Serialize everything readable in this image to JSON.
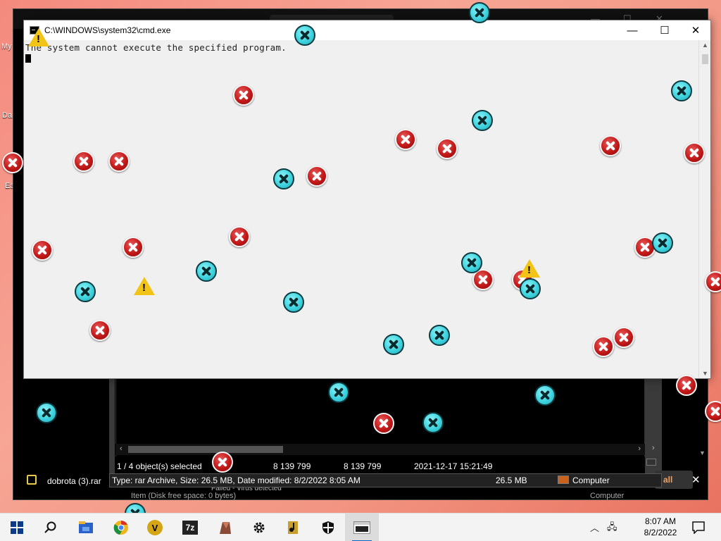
{
  "desktop": {
    "labels": [
      "My",
      "Da",
      "Ea"
    ]
  },
  "explorer": {
    "status_selected": "1 / 4 object(s) selected",
    "status_size1": "8 139 799",
    "status_size2": "8 139 799",
    "status_date": "2021-12-17 15:21:49",
    "info_text": "Type: rar Archive, Size: 26.5 MB, Date modified: 8/2/2022 8:05 AM",
    "info_size": "26.5 MB",
    "info_location": "Computer",
    "file_name": "dobrota (3).rar",
    "button_partial": "all",
    "failed_text": "Failed - Virus detected",
    "item_partial": "Item (Disk free space: 0 bytes)",
    "computer_partial": "Computer"
  },
  "cmd": {
    "title": "C:\\WINDOWS\\system32\\cmd.exe",
    "output_line": "The system cannot execute the specified program.",
    "minimize": "—",
    "maximize": "☐",
    "close": "✕"
  },
  "taskbar": {
    "icons": [
      "start-icon",
      "search-icon",
      "file-explorer-icon",
      "chrome-icon",
      "v-app-icon",
      "7zip-icon",
      "winrar-icon",
      "settings-icon",
      "media-icon",
      "defender-icon",
      "cmd-icon"
    ],
    "time": "8:07 AM",
    "date": "8/2/2022",
    "sevenzip_label": "7z",
    "v_label": "V"
  }
}
